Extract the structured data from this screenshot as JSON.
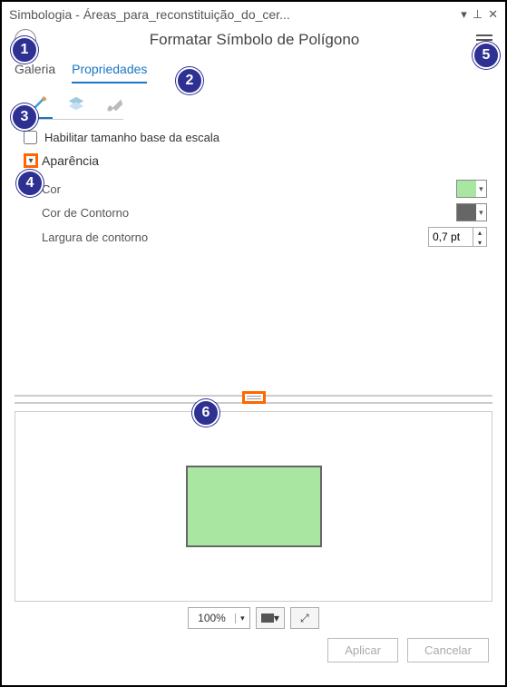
{
  "titlebar": {
    "text": "Simbologia - Áreas_para_reconstituição_do_cer..."
  },
  "header": {
    "title": "Formatar Símbolo de Polígono"
  },
  "tabs": {
    "gallery": "Galeria",
    "properties": "Propriedades"
  },
  "checkbox": {
    "scale_label": "Habilitar tamanho base da escala"
  },
  "expander": {
    "appearance": "Aparência"
  },
  "props": {
    "color_label": "Cor",
    "outline_color_label": "Cor de Contorno",
    "outline_width_label": "Largura de contorno",
    "outline_width_value": "0,7 pt",
    "fill_color": "#a8e6a1",
    "outline_color": "#666666"
  },
  "preview": {
    "zoom": "100%"
  },
  "footer": {
    "apply": "Aplicar",
    "cancel": "Cancelar"
  },
  "callouts": {
    "c1": "1",
    "c2": "2",
    "c3": "3",
    "c4": "4",
    "c5": "5",
    "c6": "6"
  }
}
